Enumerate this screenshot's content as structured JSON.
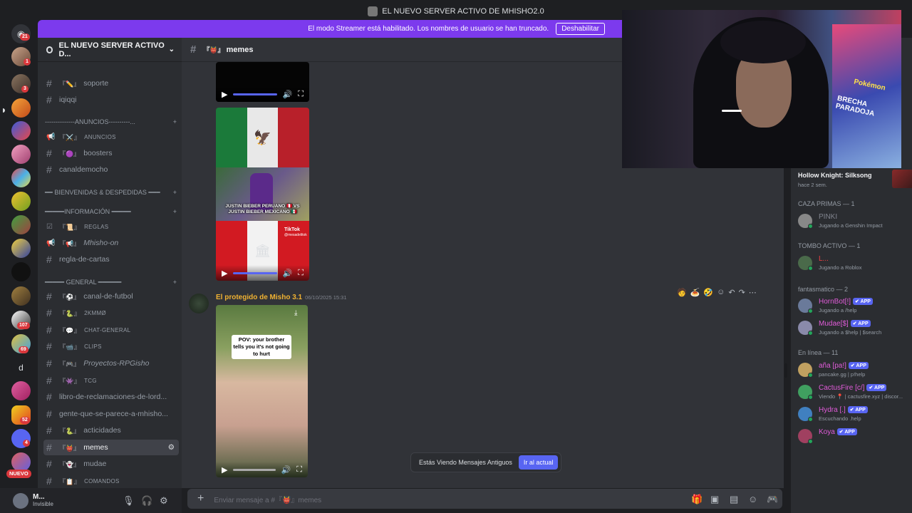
{
  "window": {
    "title": "EL NUEVO SERVER ACTIVO DE MHISHO2.0"
  },
  "banner": {
    "text": "El modo Streamer está habilitado. Los nombres de usuario se han truncado.",
    "button": "Deshabilitar"
  },
  "guilds": {
    "badges": [
      "21",
      "1",
      "3",
      "107",
      "69",
      "d",
      "52",
      "4"
    ],
    "new_label": "NUEVO"
  },
  "server": {
    "name": "EL NUEVO SERVER ACTIVO D..."
  },
  "channels": [
    {
      "name": "soporte",
      "emoji": "『✏️』",
      "type": "text"
    },
    {
      "name": "iqiqqi",
      "emoji": "",
      "type": "text"
    },
    {
      "name": "--------------ANUNCIOS----------...",
      "type": "category"
    },
    {
      "name": "ANUNCIOS",
      "emoji": "『⚔️』",
      "type": "announce",
      "small": true
    },
    {
      "name": "boosters",
      "emoji": "『🟣』",
      "type": "text"
    },
    {
      "name": "canaldemocho",
      "emoji": "",
      "type": "text"
    },
    {
      "name": "━━ BIENVENIDAS & DESPEDIDAS ━━━",
      "type": "category"
    },
    {
      "name": "━━━━━INFORMACIÓN ━━━━━",
      "type": "category"
    },
    {
      "name": "REGLAS",
      "emoji": "『📜』",
      "type": "rules",
      "small": true
    },
    {
      "name": "Mhisho-on",
      "emoji": "『📢』",
      "type": "announce",
      "italic": true
    },
    {
      "name": "regla-de-cartas",
      "emoji": "",
      "type": "text"
    },
    {
      "name": "━━━━━ GENERAL ━━━━━━",
      "type": "category"
    },
    {
      "name": "canal-de-futbol",
      "emoji": "『⚽』",
      "type": "text"
    },
    {
      "name": "2KMMØ",
      "emoji": "『🐍』",
      "type": "text",
      "small": true
    },
    {
      "name": "CHAT-GENERAL",
      "emoji": "『💬』",
      "type": "text",
      "small": true
    },
    {
      "name": "CLIPS",
      "emoji": "『📹』",
      "type": "text",
      "small": true
    },
    {
      "name": "Proyectos-RPGisho",
      "emoji": "『🎮』",
      "type": "text",
      "italic": true
    },
    {
      "name": "TCG",
      "emoji": "『👾』",
      "type": "text",
      "small": true
    },
    {
      "name": "libro-de-reclamaciones-de-lord...",
      "emoji": "",
      "type": "text"
    },
    {
      "name": "gente-que-se-parece-a-mhisho...",
      "emoji": "",
      "type": "text"
    },
    {
      "name": "acticidades",
      "emoji": "『🐍』",
      "type": "text"
    },
    {
      "name": "memes",
      "emoji": "『👹』",
      "type": "text",
      "active": true
    },
    {
      "name": "mudae",
      "emoji": "『👻』",
      "type": "text"
    },
    {
      "name": "COMANDOS",
      "emoji": "『📋』",
      "type": "text",
      "small": true
    }
  ],
  "user": {
    "name": "M...",
    "status": "Invisible"
  },
  "chat": {
    "channel_name": "memes",
    "channel_emoji": "『👹』",
    "message": {
      "author": "El protegido de Misho 3.1",
      "timestamp": "06/10/2025 15:31"
    },
    "meme_text": "JUSTIN BIEBER PERUANO 🇵🇪 VS JUSTIN BIEBER MEXICANO 🇲🇽",
    "tiktok": "TikTok",
    "tiktok_handle": "@mesadelitok",
    "pov_text": "POV: your brother tells you it's not going to hurt",
    "toast_text": "Estás Viendo Mensajes Antiguos",
    "toast_button": "Ir al actual",
    "composer_placeholder": "Enviar mensaje a #『👹』memes"
  },
  "members": {
    "game": {
      "title": "Hollow Knight: Silksong",
      "time": "hace 2 sem."
    },
    "groups": [
      {
        "label": "CAZA PRIMAS — 1",
        "items": [
          {
            "name": "PINKI",
            "activity": "Jugando a Genshin Impact",
            "color": "#80848e",
            "app": false
          }
        ]
      },
      {
        "label": "TOMBO ACTIVO — 1",
        "items": [
          {
            "name": "L...",
            "activity": "Jugando a Roblox",
            "color": "#f23f43",
            "app": false
          }
        ]
      },
      {
        "label": "fantasmatico — 2",
        "items": [
          {
            "name": "HornBot[!]",
            "activity": "Jugando a /help",
            "color": "#e05bd8",
            "app": true
          },
          {
            "name": "Mudae[$]",
            "activity": "Jugando a $help | $search",
            "color": "#e05bd8",
            "app": true
          }
        ]
      },
      {
        "label": "En línea — 11",
        "items": [
          {
            "name": "aña [pa!]",
            "activity": "pancake.gg | p!help",
            "color": "#e05bd8",
            "app": true
          },
          {
            "name": "CactusFire [c/]",
            "activity": "Viendo 📍 | cactusfire.xyz | discor...",
            "color": "#e05bd8",
            "app": true
          },
          {
            "name": "Hydra [.]",
            "activity": "Escuchando .help",
            "color": "#e05bd8",
            "app": true
          },
          {
            "name": "Koya",
            "activity": "",
            "color": "#e05bd8",
            "app": true
          }
        ]
      }
    ],
    "app_label": "✔ APP"
  },
  "webcam": {
    "poster_brand": "Pokémon",
    "poster_title": "BRECHA PARADOJA"
  }
}
